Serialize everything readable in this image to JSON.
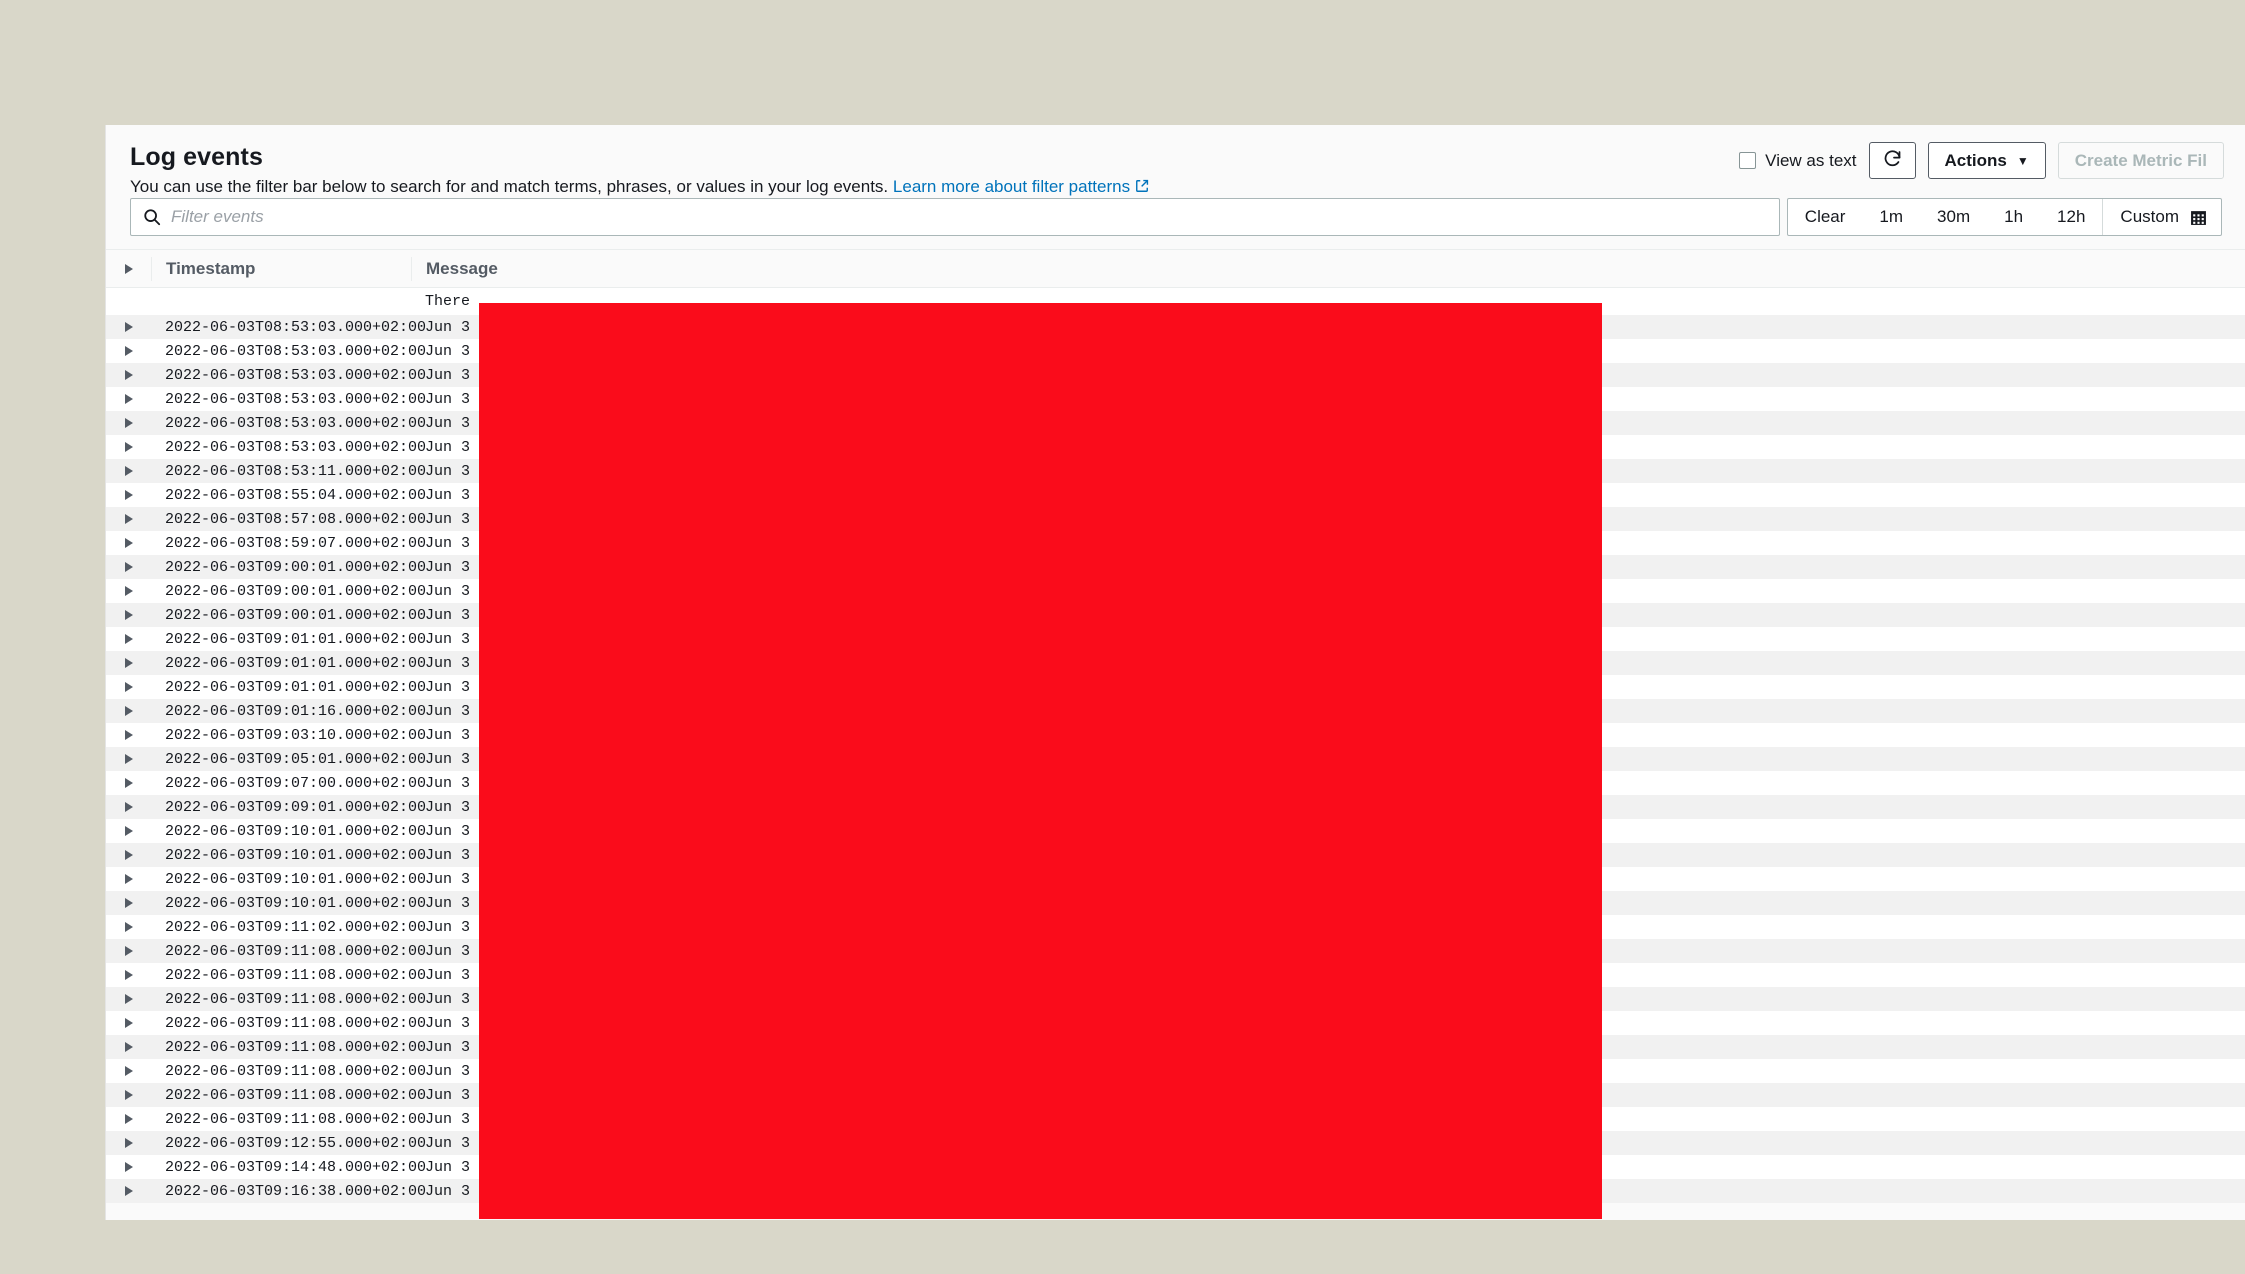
{
  "page": {
    "background_color": "#d9d7c9",
    "card_background": "#fafafa"
  },
  "header": {
    "title": "Log events",
    "description": "You can use the filter bar below to search for and match terms, phrases, or values in your log events.",
    "link_text": "Learn more about filter patterns",
    "link_icon": "external-link-icon"
  },
  "controls": {
    "view_as_text_label": "View as text",
    "view_as_text_checked": false,
    "refresh_icon": "refresh-icon",
    "actions_label": "Actions",
    "actions_caret": "▼",
    "create_metric_filter_label": "Create Metric Fil",
    "create_metric_filter_disabled": true
  },
  "search": {
    "icon": "search-icon",
    "placeholder": "Filter events",
    "value": ""
  },
  "time_range": {
    "options": [
      "Clear",
      "1m",
      "30m",
      "1h",
      "12h"
    ],
    "custom_label": "Custom",
    "custom_icon": "calendar-icon"
  },
  "table": {
    "columns": {
      "toggle_icon": "expand-all-icon",
      "timestamp": "Timestamp",
      "message": "Message"
    },
    "first_row": {
      "timestamp": "",
      "message": "There"
    },
    "rows": [
      {
        "timestamp": "2022-06-03T08:53:03.000+02:00",
        "message": "Jun 3"
      },
      {
        "timestamp": "2022-06-03T08:53:03.000+02:00",
        "message": "Jun 3"
      },
      {
        "timestamp": "2022-06-03T08:53:03.000+02:00",
        "message": "Jun 3"
      },
      {
        "timestamp": "2022-06-03T08:53:03.000+02:00",
        "message": "Jun 3"
      },
      {
        "timestamp": "2022-06-03T08:53:03.000+02:00",
        "message": "Jun 3"
      },
      {
        "timestamp": "2022-06-03T08:53:03.000+02:00",
        "message": "Jun 3"
      },
      {
        "timestamp": "2022-06-03T08:53:11.000+02:00",
        "message": "Jun 3"
      },
      {
        "timestamp": "2022-06-03T08:55:04.000+02:00",
        "message": "Jun 3"
      },
      {
        "timestamp": "2022-06-03T08:57:08.000+02:00",
        "message": "Jun 3"
      },
      {
        "timestamp": "2022-06-03T08:59:07.000+02:00",
        "message": "Jun 3"
      },
      {
        "timestamp": "2022-06-03T09:00:01.000+02:00",
        "message": "Jun 3"
      },
      {
        "timestamp": "2022-06-03T09:00:01.000+02:00",
        "message": "Jun 3"
      },
      {
        "timestamp": "2022-06-03T09:00:01.000+02:00",
        "message": "Jun 3"
      },
      {
        "timestamp": "2022-06-03T09:01:01.000+02:00",
        "message": "Jun 3"
      },
      {
        "timestamp": "2022-06-03T09:01:01.000+02:00",
        "message": "Jun 3"
      },
      {
        "timestamp": "2022-06-03T09:01:01.000+02:00",
        "message": "Jun 3"
      },
      {
        "timestamp": "2022-06-03T09:01:16.000+02:00",
        "message": "Jun 3"
      },
      {
        "timestamp": "2022-06-03T09:03:10.000+02:00",
        "message": "Jun 3"
      },
      {
        "timestamp": "2022-06-03T09:05:01.000+02:00",
        "message": "Jun 3"
      },
      {
        "timestamp": "2022-06-03T09:07:00.000+02:00",
        "message": "Jun 3"
      },
      {
        "timestamp": "2022-06-03T09:09:01.000+02:00",
        "message": "Jun 3"
      },
      {
        "timestamp": "2022-06-03T09:10:01.000+02:00",
        "message": "Jun 3"
      },
      {
        "timestamp": "2022-06-03T09:10:01.000+02:00",
        "message": "Jun 3"
      },
      {
        "timestamp": "2022-06-03T09:10:01.000+02:00",
        "message": "Jun 3"
      },
      {
        "timestamp": "2022-06-03T09:10:01.000+02:00",
        "message": "Jun 3"
      },
      {
        "timestamp": "2022-06-03T09:11:02.000+02:00",
        "message": "Jun 3"
      },
      {
        "timestamp": "2022-06-03T09:11:08.000+02:00",
        "message": "Jun 3"
      },
      {
        "timestamp": "2022-06-03T09:11:08.000+02:00",
        "message": "Jun 3"
      },
      {
        "timestamp": "2022-06-03T09:11:08.000+02:00",
        "message": "Jun 3"
      },
      {
        "timestamp": "2022-06-03T09:11:08.000+02:00",
        "message": "Jun 3"
      },
      {
        "timestamp": "2022-06-03T09:11:08.000+02:00",
        "message": "Jun 3"
      },
      {
        "timestamp": "2022-06-03T09:11:08.000+02:00",
        "message": "Jun 3"
      },
      {
        "timestamp": "2022-06-03T09:11:08.000+02:00",
        "message": "Jun 3"
      },
      {
        "timestamp": "2022-06-03T09:11:08.000+02:00",
        "message": "Jun 3"
      },
      {
        "timestamp": "2022-06-03T09:12:55.000+02:00",
        "message": "Jun 3"
      },
      {
        "timestamp": "2022-06-03T09:14:48.000+02:00",
        "message": "Jun 3"
      },
      {
        "timestamp": "2022-06-03T09:16:38.000+02:00",
        "message": "Jun 3"
      }
    ]
  },
  "redaction": {
    "color": "#fa0c1b"
  }
}
